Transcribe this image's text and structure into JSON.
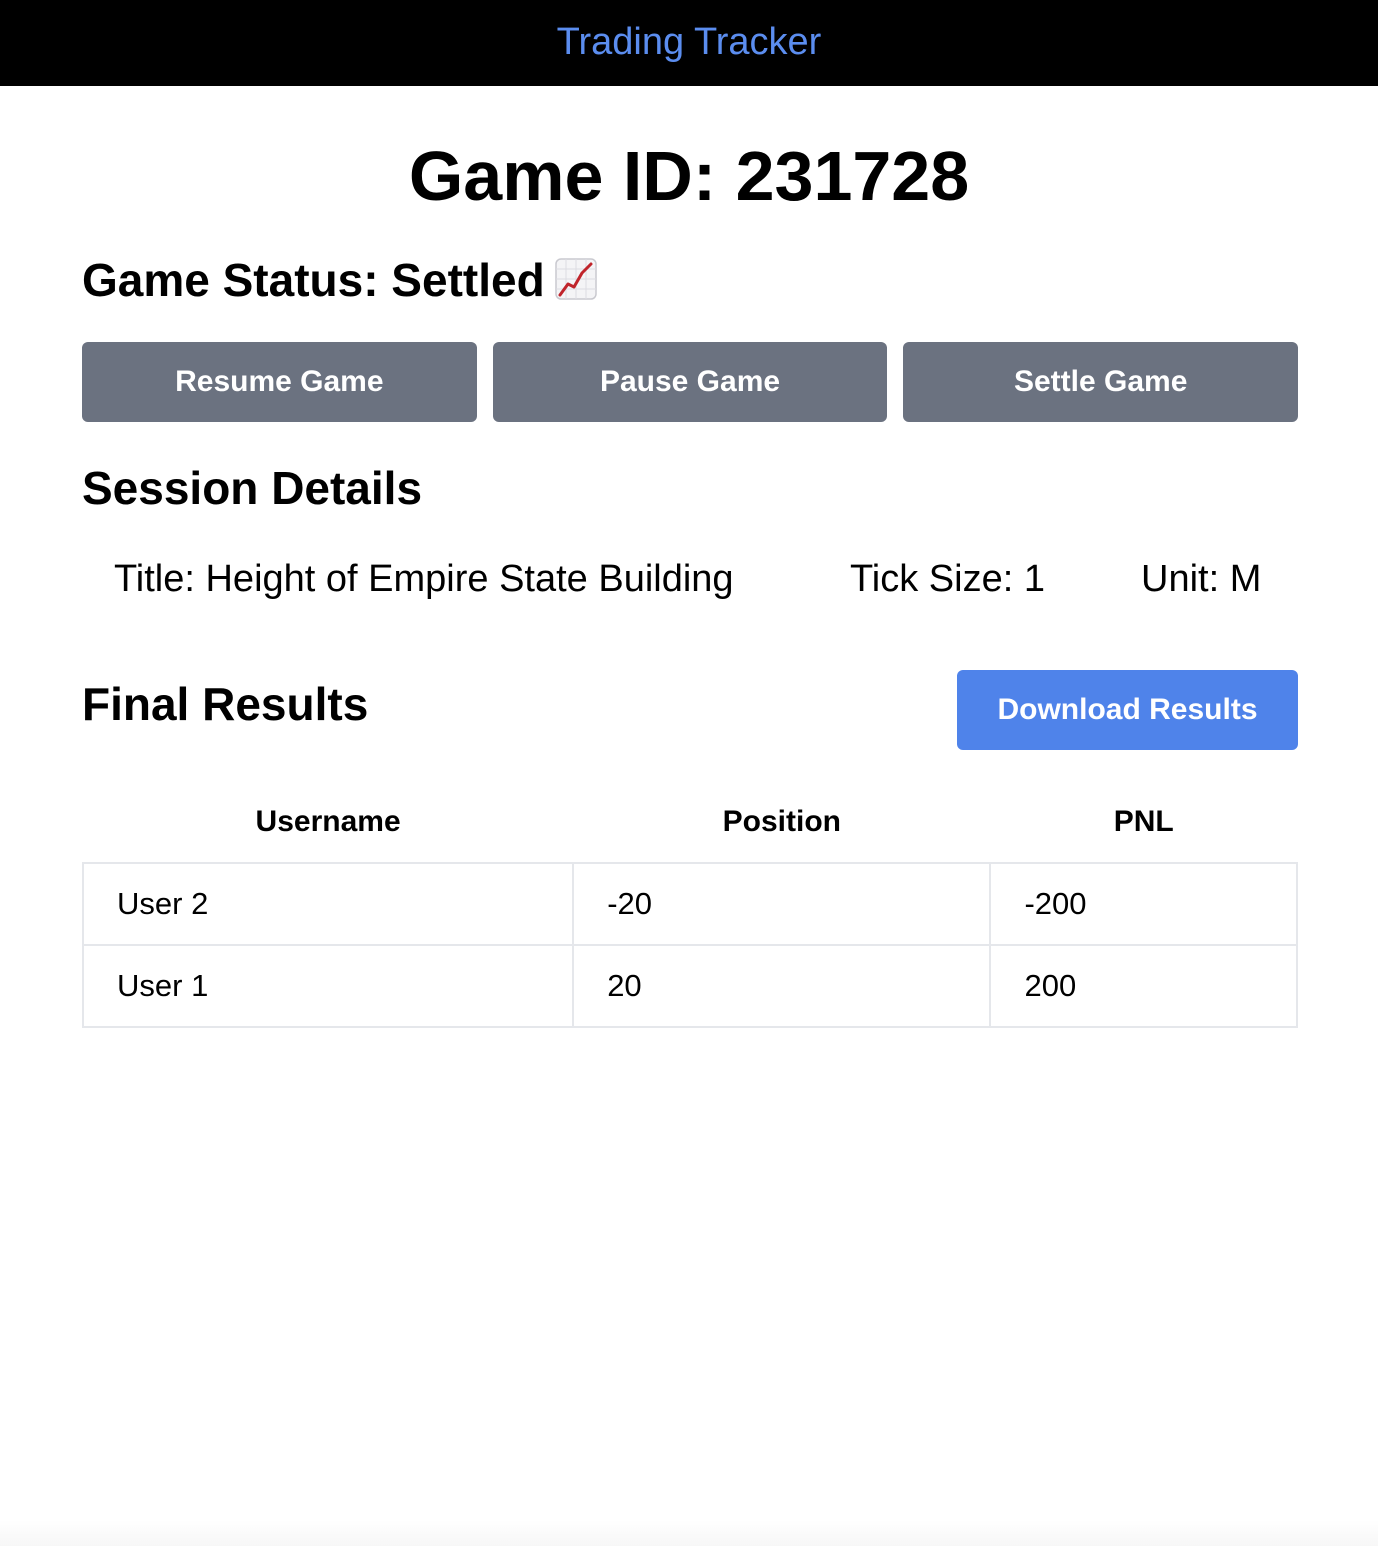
{
  "header": {
    "brand": "Trading Tracker",
    "brand_color": "#5b8def"
  },
  "game": {
    "id_label": "Game ID: 231728",
    "status_label": "Game Status: Settled",
    "status_icon": "chart-increasing-icon"
  },
  "controls": {
    "resume_label": "Resume Game",
    "pause_label": "Pause Game",
    "settle_label": "Settle Game",
    "button_color": "#6b7280"
  },
  "session": {
    "heading": "Session Details",
    "title": "Title: Height of Empire State Building",
    "tick_size": "Tick Size: 1",
    "unit": "Unit: M"
  },
  "results": {
    "heading": "Final Results",
    "download_label": "Download Results",
    "download_color": "#4f83ea",
    "columns": [
      "Username",
      "Position",
      "PNL"
    ],
    "rows": [
      [
        "User 2",
        "-20",
        "-200"
      ],
      [
        "User 1",
        "20",
        "200"
      ]
    ]
  }
}
